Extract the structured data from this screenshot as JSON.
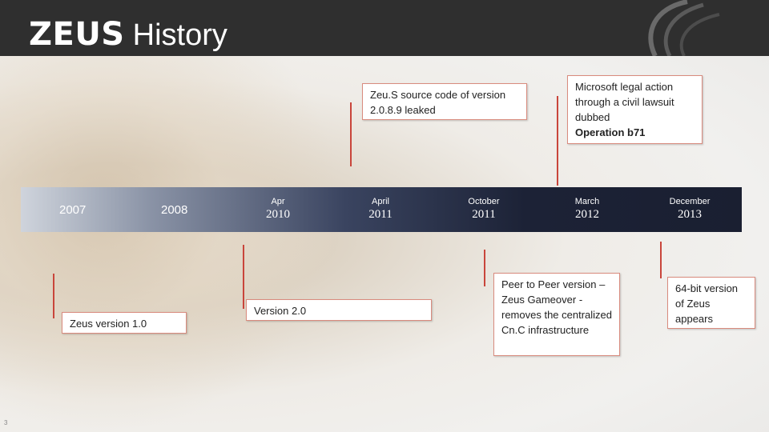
{
  "slide": {
    "title_brand": "ZEUS",
    "title_rest": "History",
    "slide_number": "3",
    "accent_color": "#c9453b",
    "header_color": "#2f2f2f"
  },
  "timeline": {
    "years": [
      {
        "month": "",
        "year": "2007"
      },
      {
        "month": "",
        "year": "2008"
      },
      {
        "month": "Apr",
        "year": "2010"
      },
      {
        "month": "April",
        "year": "2011"
      },
      {
        "month": "October",
        "year": "2011"
      },
      {
        "month": "March",
        "year": "2012"
      },
      {
        "month": "December",
        "year": "2013"
      }
    ]
  },
  "events": {
    "zeus_v1": "Zeus version 1.0",
    "zeus_v2": "Version 2.0",
    "source_leak": "Zeu.S source code of version 2.0.8.9 leaked",
    "microsoft_text": "Microsoft legal action through a civil lawsuit dubbed",
    "microsoft_bold": "Operation b71",
    "p2p": "Peer to Peer version – Zeus Gameover - removes the centralized Cn.C infrastructure",
    "x64": "64-bit version of Zeus appears"
  }
}
